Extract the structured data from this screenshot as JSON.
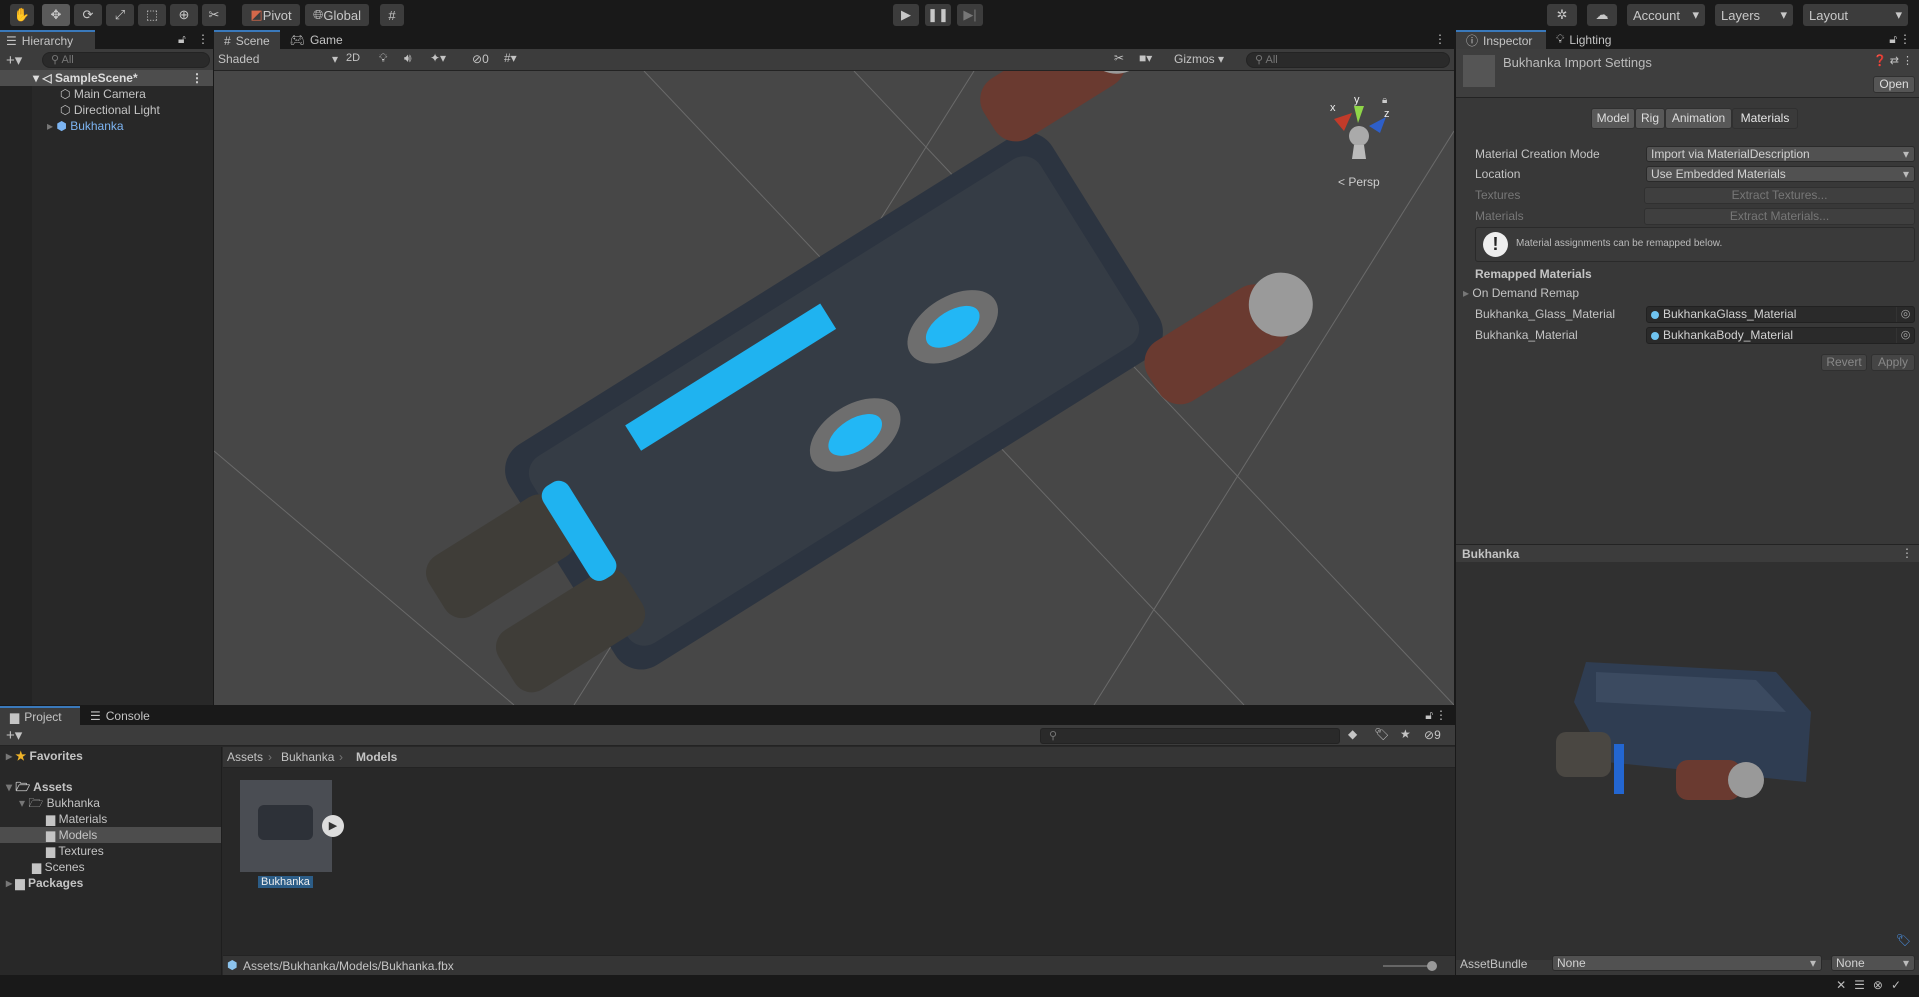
{
  "toolbar": {
    "tools": [
      "hand-tool",
      "move-tool",
      "rotate-tool",
      "scale-tool",
      "rect-tool",
      "transform-tool",
      "custom-tool"
    ],
    "pivot": "Pivot",
    "global": "Global",
    "account": "Account",
    "layers": "Layers",
    "layout": "Layout"
  },
  "hierarchy": {
    "tab": "Hierarchy",
    "search_placeholder": "All",
    "items": [
      {
        "label": "SampleScene*"
      },
      {
        "label": "Main Camera"
      },
      {
        "label": "Directional Light"
      },
      {
        "label": "Bukhanka"
      }
    ]
  },
  "scene": {
    "tabs": [
      "Scene",
      "Game"
    ],
    "shading": "Shaded",
    "mode_2d": "2D",
    "hidden_count": "0",
    "gizmos": "Gizmos",
    "search_placeholder": "All",
    "projection": "Persp",
    "axes": {
      "x": "x",
      "y": "y",
      "z": "z"
    }
  },
  "inspector": {
    "tabs": [
      "Inspector",
      "Lighting"
    ],
    "title": "Bukhanka Import Settings",
    "open": "Open",
    "subtabs": [
      "Model",
      "Rig",
      "Animation",
      "Materials"
    ],
    "active_subtab": "Materials",
    "fields": [
      {
        "label": "Material Creation Mode",
        "value": "Import via MaterialDescription"
      },
      {
        "label": "Location",
        "value": "Use Embedded Materials"
      },
      {
        "label": "Textures",
        "value": "Extract Textures..."
      },
      {
        "label": "Materials",
        "value": "Extract Materials..."
      }
    ],
    "info": "Material assignments can be remapped below.",
    "remapped_header": "Remapped Materials",
    "on_demand": "On Demand Remap",
    "remaps": [
      {
        "label": "Bukhanka_Glass_Material",
        "value": "BukhankaGlass_Material"
      },
      {
        "label": "Bukhanka_Material",
        "value": "BukhankaBody_Material"
      }
    ],
    "revert": "Revert",
    "apply": "Apply",
    "preview_title": "Bukhanka",
    "asset_bundle": "AssetBundle",
    "bundle_value": "None",
    "bundle_variant": "None"
  },
  "project": {
    "tabs": [
      "Project",
      "Console"
    ],
    "hidden_count": "9",
    "favorites": "Favorites",
    "tree": [
      {
        "label": "Assets"
      },
      {
        "label": "Bukhanka"
      },
      {
        "label": "Materials"
      },
      {
        "label": "Models"
      },
      {
        "label": "Textures"
      },
      {
        "label": "Scenes"
      },
      {
        "label": "Packages"
      }
    ],
    "breadcrumb": [
      "Assets",
      "Bukhanka",
      "Models"
    ],
    "asset": "Bukhanka",
    "path": "Assets/Bukhanka/Models/Bukhanka.fbx"
  }
}
